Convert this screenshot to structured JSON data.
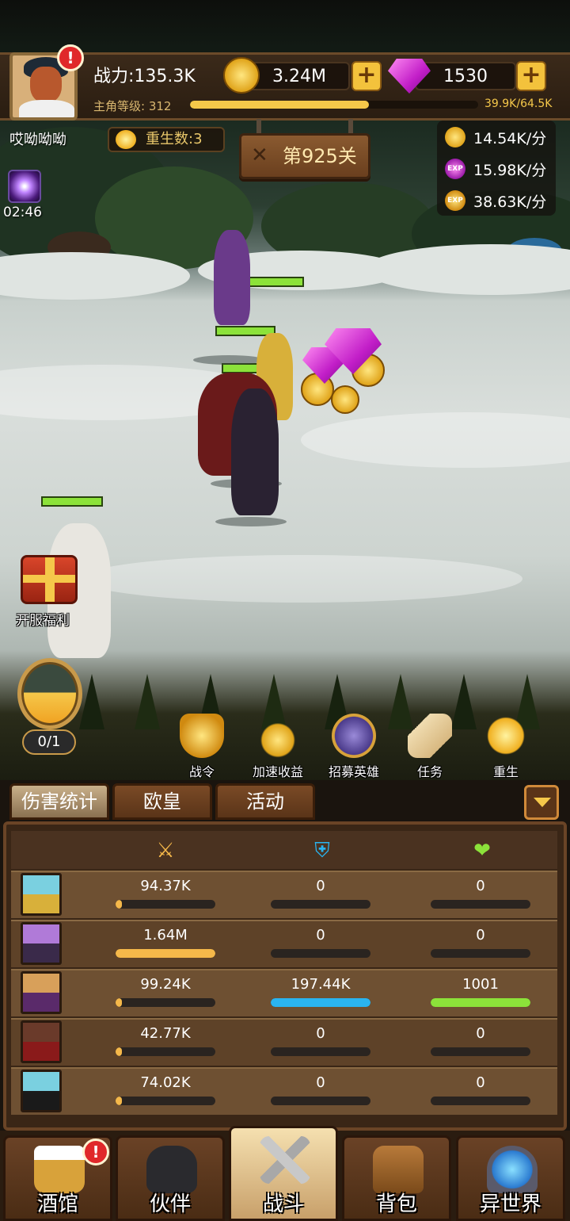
{
  "header": {
    "power": "战力:135.3K",
    "gold": "3.24M",
    "gems": "1530",
    "level_label": "主角等级:",
    "level": "312",
    "level_xp": "39.9K/64.5K",
    "level_progress": 0.62
  },
  "player_name": "哎呦呦呦",
  "rebirth": "重生数:3",
  "portal_timer": "02:46",
  "stage": "第925关",
  "rates": [
    {
      "icon": "gold-coin-icon",
      "value": "14.54K/分"
    },
    {
      "icon": "exp-flame-icon",
      "icon_text": "EXP",
      "value": "15.98K/分"
    },
    {
      "icon": "gold-exp-icon",
      "icon_text": "EXP",
      "value": "38.63K/分"
    }
  ],
  "gift_label": "开服福利",
  "potion_count": "0/1",
  "actions": [
    {
      "label": "战令",
      "icon": "sword-shield-icon"
    },
    {
      "label": "加速收益",
      "icon": "coins-speed-icon"
    },
    {
      "label": "招募英雄",
      "icon": "helmet-icon"
    },
    {
      "label": "任务",
      "icon": "scroll-icon"
    },
    {
      "label": "重生",
      "icon": "rebirth-plus-icon"
    }
  ],
  "tabs": [
    "伤害统计",
    "欧皇",
    "活动"
  ],
  "stats_columns": [
    "damage-swords-icon",
    "defense-shield-icon",
    "heal-hand-icon"
  ],
  "stats": [
    {
      "damage": "94.37K",
      "defense": "0",
      "heal": "0",
      "damage_frac": 0.06,
      "defense_frac": 0,
      "heal_frac": 0
    },
    {
      "damage": "1.64M",
      "defense": "0",
      "heal": "0",
      "damage_frac": 1.0,
      "defense_frac": 0,
      "heal_frac": 0
    },
    {
      "damage": "99.24K",
      "defense": "197.44K",
      "heal": "1001",
      "damage_frac": 0.06,
      "defense_frac": 1.0,
      "heal_frac": 1.0
    },
    {
      "damage": "42.77K",
      "defense": "0",
      "heal": "0",
      "damage_frac": 0.03,
      "defense_frac": 0,
      "heal_frac": 0
    },
    {
      "damage": "74.02K",
      "defense": "0",
      "heal": "0",
      "damage_frac": 0.05,
      "defense_frac": 0,
      "heal_frac": 0
    }
  ],
  "nav": [
    {
      "label": "酒馆",
      "icon": "beer-mug-icon",
      "badge": "!"
    },
    {
      "label": "伙伴",
      "icon": "partner-icon"
    },
    {
      "label": "战斗",
      "icon": "crossed-swords-icon"
    },
    {
      "label": "背包",
      "icon": "backpack-icon"
    },
    {
      "label": "异世界",
      "icon": "portal-gate-icon"
    }
  ],
  "avatar_badge": "!",
  "colors": {
    "gold": "#f5c84a",
    "damage_bar": "#f5b84a",
    "defense_bar": "#2ab4f0",
    "heal_bar": "#8ce23a"
  }
}
